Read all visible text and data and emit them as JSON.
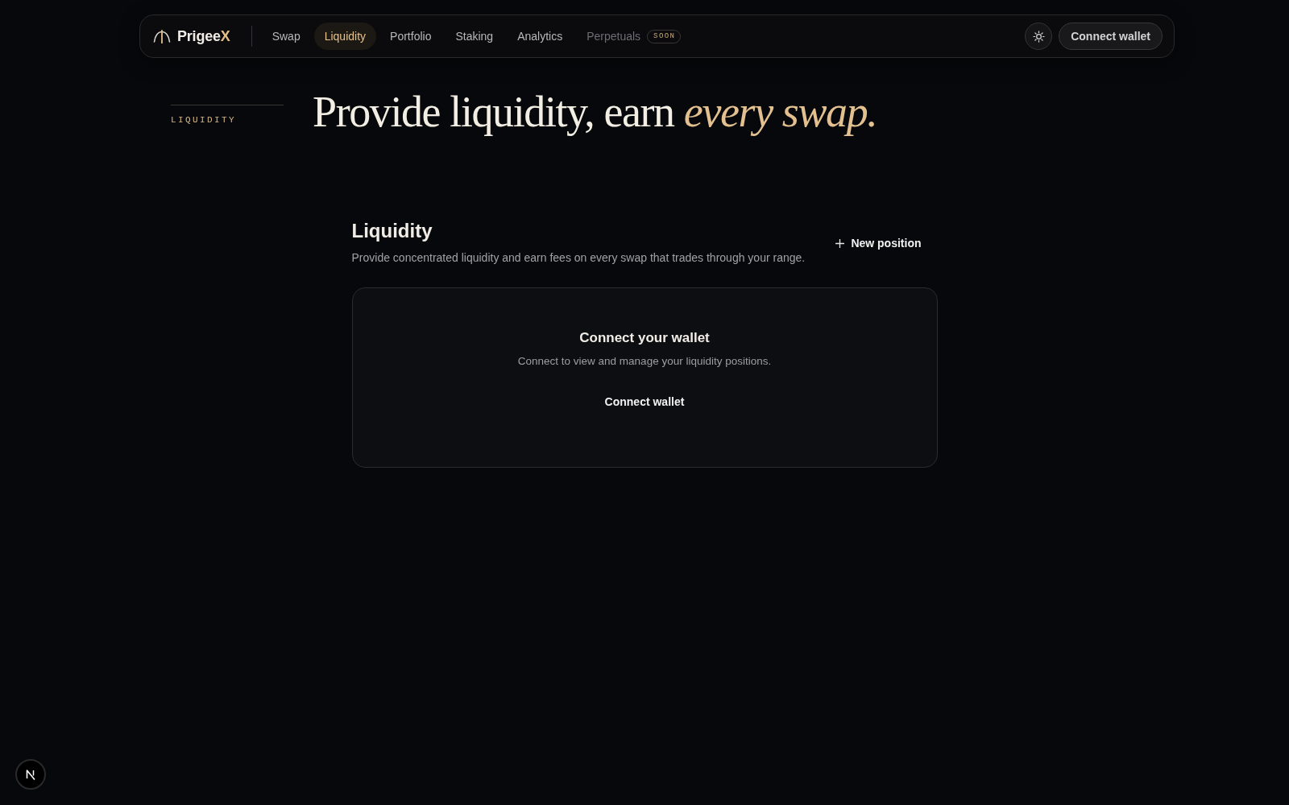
{
  "navbar": {
    "brand": {
      "name": "Prigee",
      "accent": "X"
    },
    "links": [
      {
        "label": "Swap",
        "selected": false,
        "disabled": false
      },
      {
        "label": "Liquidity",
        "selected": true,
        "disabled": false
      },
      {
        "label": "Portfolio",
        "selected": false,
        "disabled": false
      },
      {
        "label": "Staking",
        "selected": false,
        "disabled": false
      },
      {
        "label": "Analytics",
        "selected": false,
        "disabled": false
      },
      {
        "label": "Perpetuals",
        "selected": false,
        "disabled": true,
        "badge": "SOON"
      }
    ],
    "connect_button": "Connect wallet"
  },
  "hero": {
    "eyebrow": "LIQUIDITY",
    "title": "Provide liquidity, earn *every swap.*"
  },
  "section": {
    "title": "Liquidity",
    "subtitle": "Provide concentrated liquidity and earn fees on every swap that trades through your range.",
    "new_position_button": "New position"
  },
  "empty_state": {
    "title": "Connect your wallet",
    "text": "Connect to view and manage your liquidity positions.",
    "button": "Connect wallet"
  }
}
